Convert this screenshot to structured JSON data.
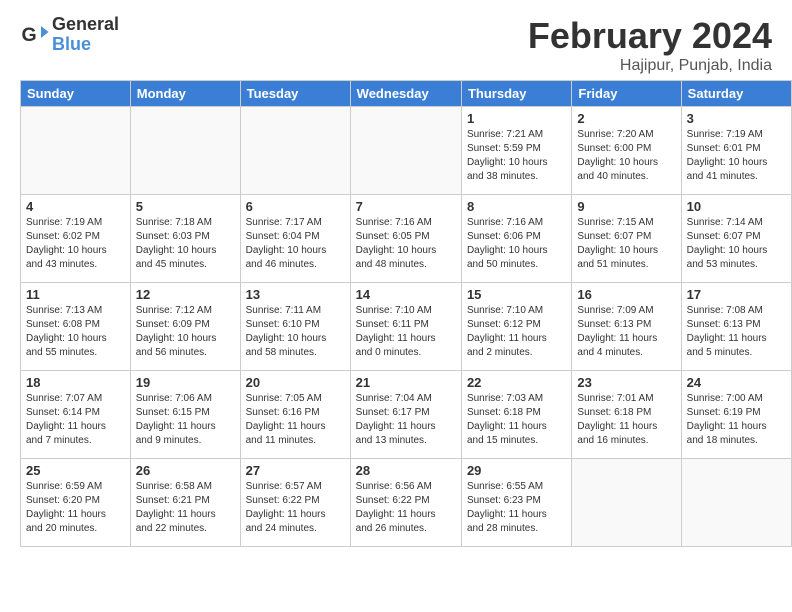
{
  "header": {
    "logo_line1": "General",
    "logo_line2": "Blue",
    "month_year": "February 2024",
    "location": "Hajipur, Punjab, India"
  },
  "weekdays": [
    "Sunday",
    "Monday",
    "Tuesday",
    "Wednesday",
    "Thursday",
    "Friday",
    "Saturday"
  ],
  "weeks": [
    [
      {
        "day": "",
        "info": ""
      },
      {
        "day": "",
        "info": ""
      },
      {
        "day": "",
        "info": ""
      },
      {
        "day": "",
        "info": ""
      },
      {
        "day": "1",
        "info": "Sunrise: 7:21 AM\nSunset: 5:59 PM\nDaylight: 10 hours\nand 38 minutes."
      },
      {
        "day": "2",
        "info": "Sunrise: 7:20 AM\nSunset: 6:00 PM\nDaylight: 10 hours\nand 40 minutes."
      },
      {
        "day": "3",
        "info": "Sunrise: 7:19 AM\nSunset: 6:01 PM\nDaylight: 10 hours\nand 41 minutes."
      }
    ],
    [
      {
        "day": "4",
        "info": "Sunrise: 7:19 AM\nSunset: 6:02 PM\nDaylight: 10 hours\nand 43 minutes."
      },
      {
        "day": "5",
        "info": "Sunrise: 7:18 AM\nSunset: 6:03 PM\nDaylight: 10 hours\nand 45 minutes."
      },
      {
        "day": "6",
        "info": "Sunrise: 7:17 AM\nSunset: 6:04 PM\nDaylight: 10 hours\nand 46 minutes."
      },
      {
        "day": "7",
        "info": "Sunrise: 7:16 AM\nSunset: 6:05 PM\nDaylight: 10 hours\nand 48 minutes."
      },
      {
        "day": "8",
        "info": "Sunrise: 7:16 AM\nSunset: 6:06 PM\nDaylight: 10 hours\nand 50 minutes."
      },
      {
        "day": "9",
        "info": "Sunrise: 7:15 AM\nSunset: 6:07 PM\nDaylight: 10 hours\nand 51 minutes."
      },
      {
        "day": "10",
        "info": "Sunrise: 7:14 AM\nSunset: 6:07 PM\nDaylight: 10 hours\nand 53 minutes."
      }
    ],
    [
      {
        "day": "11",
        "info": "Sunrise: 7:13 AM\nSunset: 6:08 PM\nDaylight: 10 hours\nand 55 minutes."
      },
      {
        "day": "12",
        "info": "Sunrise: 7:12 AM\nSunset: 6:09 PM\nDaylight: 10 hours\nand 56 minutes."
      },
      {
        "day": "13",
        "info": "Sunrise: 7:11 AM\nSunset: 6:10 PM\nDaylight: 10 hours\nand 58 minutes."
      },
      {
        "day": "14",
        "info": "Sunrise: 7:10 AM\nSunset: 6:11 PM\nDaylight: 11 hours\nand 0 minutes."
      },
      {
        "day": "15",
        "info": "Sunrise: 7:10 AM\nSunset: 6:12 PM\nDaylight: 11 hours\nand 2 minutes."
      },
      {
        "day": "16",
        "info": "Sunrise: 7:09 AM\nSunset: 6:13 PM\nDaylight: 11 hours\nand 4 minutes."
      },
      {
        "day": "17",
        "info": "Sunrise: 7:08 AM\nSunset: 6:13 PM\nDaylight: 11 hours\nand 5 minutes."
      }
    ],
    [
      {
        "day": "18",
        "info": "Sunrise: 7:07 AM\nSunset: 6:14 PM\nDaylight: 11 hours\nand 7 minutes."
      },
      {
        "day": "19",
        "info": "Sunrise: 7:06 AM\nSunset: 6:15 PM\nDaylight: 11 hours\nand 9 minutes."
      },
      {
        "day": "20",
        "info": "Sunrise: 7:05 AM\nSunset: 6:16 PM\nDaylight: 11 hours\nand 11 minutes."
      },
      {
        "day": "21",
        "info": "Sunrise: 7:04 AM\nSunset: 6:17 PM\nDaylight: 11 hours\nand 13 minutes."
      },
      {
        "day": "22",
        "info": "Sunrise: 7:03 AM\nSunset: 6:18 PM\nDaylight: 11 hours\nand 15 minutes."
      },
      {
        "day": "23",
        "info": "Sunrise: 7:01 AM\nSunset: 6:18 PM\nDaylight: 11 hours\nand 16 minutes."
      },
      {
        "day": "24",
        "info": "Sunrise: 7:00 AM\nSunset: 6:19 PM\nDaylight: 11 hours\nand 18 minutes."
      }
    ],
    [
      {
        "day": "25",
        "info": "Sunrise: 6:59 AM\nSunset: 6:20 PM\nDaylight: 11 hours\nand 20 minutes."
      },
      {
        "day": "26",
        "info": "Sunrise: 6:58 AM\nSunset: 6:21 PM\nDaylight: 11 hours\nand 22 minutes."
      },
      {
        "day": "27",
        "info": "Sunrise: 6:57 AM\nSunset: 6:22 PM\nDaylight: 11 hours\nand 24 minutes."
      },
      {
        "day": "28",
        "info": "Sunrise: 6:56 AM\nSunset: 6:22 PM\nDaylight: 11 hours\nand 26 minutes."
      },
      {
        "day": "29",
        "info": "Sunrise: 6:55 AM\nSunset: 6:23 PM\nDaylight: 11 hours\nand 28 minutes."
      },
      {
        "day": "",
        "info": ""
      },
      {
        "day": "",
        "info": ""
      }
    ]
  ]
}
